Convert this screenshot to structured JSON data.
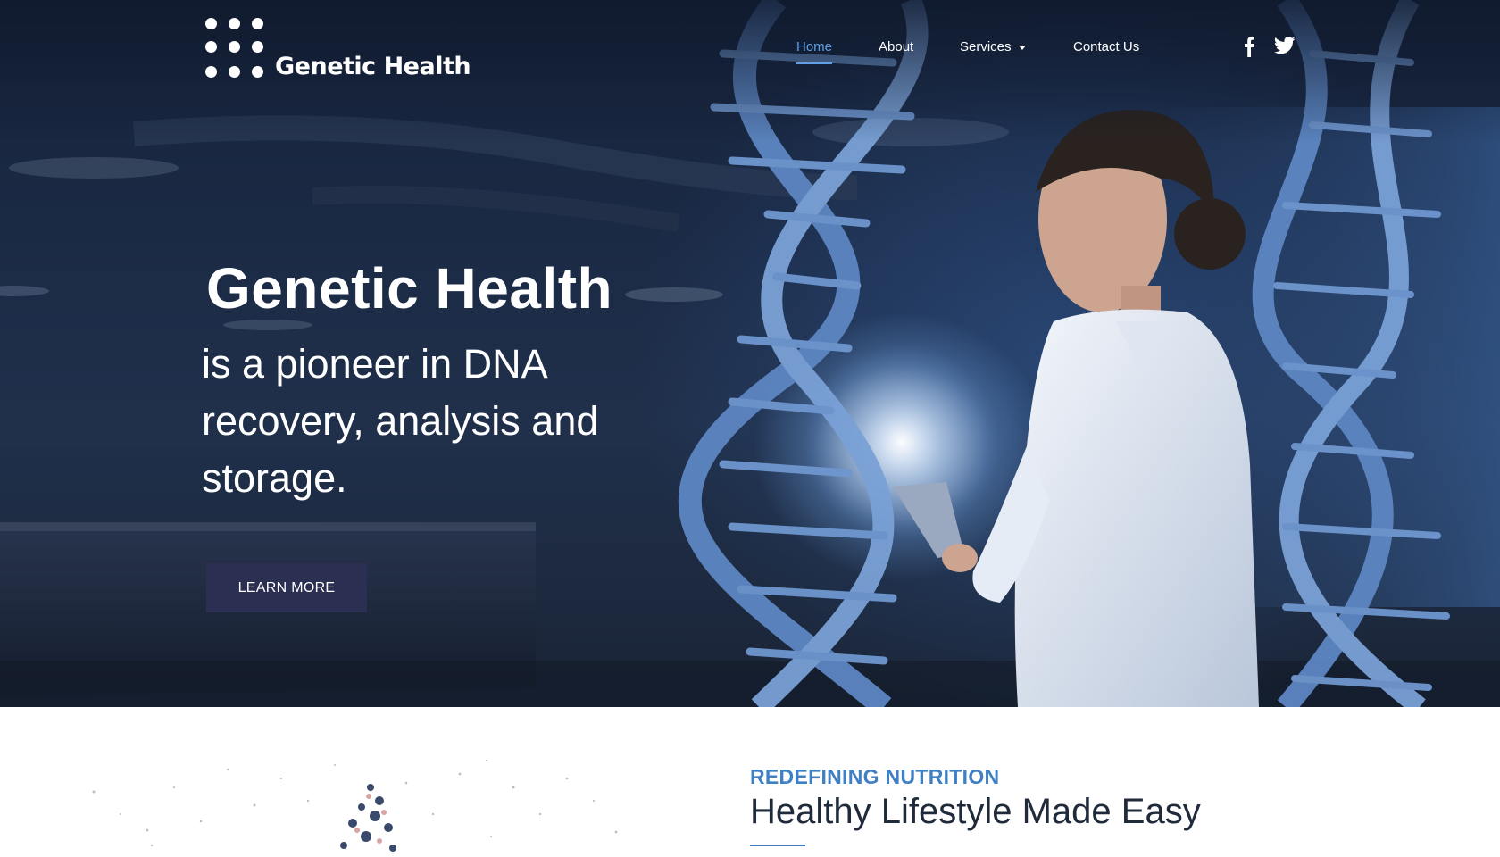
{
  "brand": {
    "name": "Genetic Health"
  },
  "nav": {
    "items": [
      {
        "label": "Home",
        "active": true
      },
      {
        "label": "About"
      },
      {
        "label": "Services",
        "has_dropdown": true
      },
      {
        "label": "Contact Us"
      }
    ]
  },
  "social": {
    "icons": [
      "facebook-icon",
      "twitter-icon"
    ]
  },
  "hero": {
    "title": "Genetic Health",
    "subtitle": "is a pioneer in DNA recovery, analysis and storage.",
    "button_label": "LEARN MORE"
  },
  "section": {
    "eyebrow": "REDEFINING NUTRITION",
    "title": "Healthy Lifestyle Made Easy"
  },
  "colors": {
    "accent": "#5fa0e8",
    "eyebrow": "#3f7fc4",
    "button_bg": "#2b2f52",
    "hero_bg": "#1b2a45",
    "heading_dark": "#1f2a3a"
  }
}
